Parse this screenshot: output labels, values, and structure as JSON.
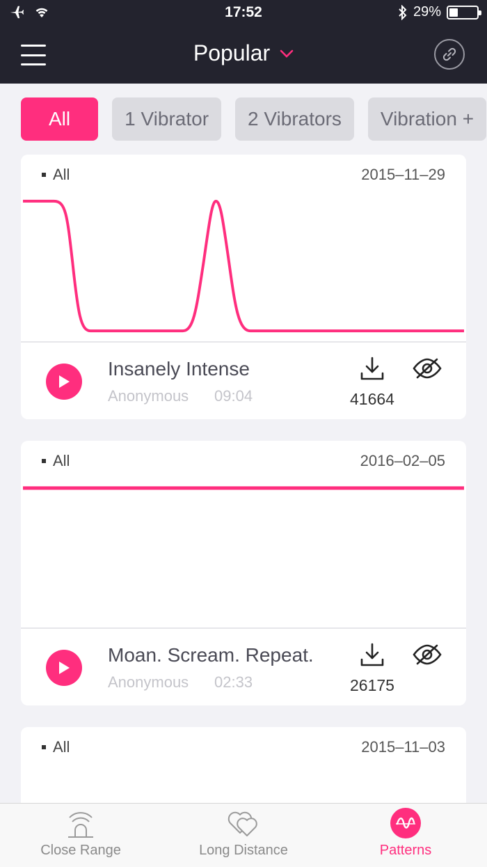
{
  "status_bar": {
    "time": "17:52",
    "battery": "29%",
    "battery_level": 0.29
  },
  "header": {
    "title": "Popular"
  },
  "filters": [
    {
      "label": "All",
      "active": true
    },
    {
      "label": "1 Vibrator",
      "active": false
    },
    {
      "label": "2 Vibrators",
      "active": false
    },
    {
      "label": "Vibration +",
      "active": false
    }
  ],
  "patterns": [
    {
      "category": "All",
      "date": "2015–11–29",
      "name": "Insanely Intense",
      "author": "Anonymous",
      "duration": "09:04",
      "downloads": "41664"
    },
    {
      "category": "All",
      "date": "2016–02–05",
      "name": "Moan. Scream. Repeat.",
      "author": "Anonymous",
      "duration": "02:33",
      "downloads": "26175"
    },
    {
      "category": "All",
      "date": "2015–11–03"
    }
  ],
  "tabs": [
    {
      "label": "Close Range",
      "icon": "close-range-icon"
    },
    {
      "label": "Long Distance",
      "icon": "long-distance-icon"
    },
    {
      "label": "Patterns",
      "icon": "patterns-icon",
      "active": true
    }
  ],
  "colors": {
    "accent": "#ff2e7e",
    "header_bg": "#23232e",
    "page_bg": "#f2f2f6"
  }
}
